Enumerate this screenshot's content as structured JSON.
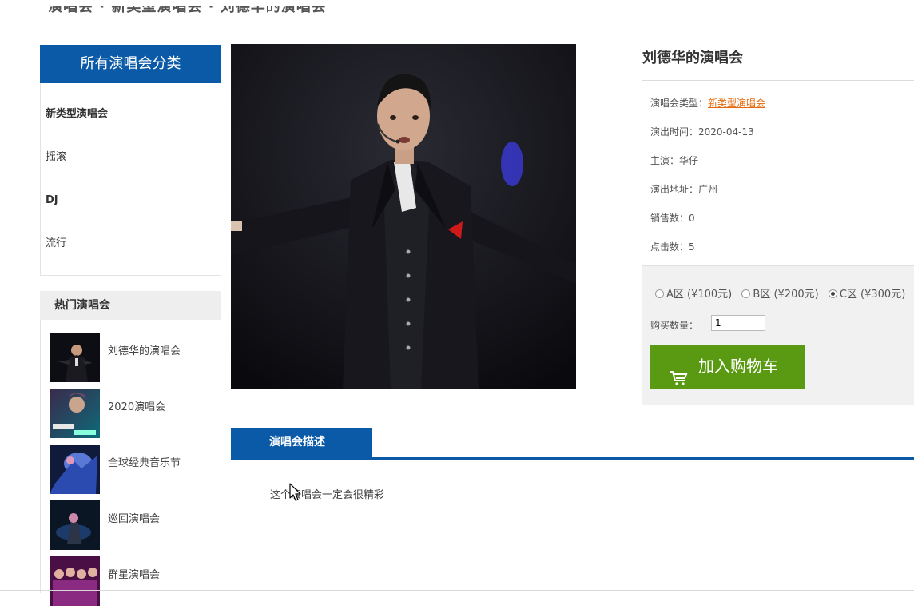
{
  "breadcrumb": "演唱会 · 新类型演唱会 · 刘德华的演唱会",
  "categories": {
    "heading": "所有演唱会分类",
    "items": [
      "新类型演唱会",
      "摇滚",
      "DJ",
      "流行"
    ]
  },
  "hot": {
    "heading": "热门演唱会",
    "items": [
      "刘德华的演唱会",
      "2020演唱会",
      "全球经典音乐节",
      "巡回演唱会",
      "群星演唱会"
    ]
  },
  "detail": {
    "title": "刘德华的演唱会",
    "type_label": "演唱会类型：",
    "type_value": "新类型演唱会",
    "time": "演出时间：2020-04-13",
    "star": "主演：华仔",
    "address": "演出地址：广州",
    "sales": "销售数：0",
    "clicks": "点击数：5"
  },
  "purchase": {
    "zones": [
      "A区 (¥100元)",
      "B区 (¥200元)",
      "C区 (¥300元)"
    ],
    "selected_zone": 2,
    "qty_label": "购买数量：",
    "qty_value": "1",
    "cart_label": "加入购物车"
  },
  "description": {
    "tab_label": "演唱会描述",
    "text": "这个演唱会一定会很精彩"
  },
  "colors": {
    "brand_blue": "#0b5aa8",
    "cart_green": "#5a9a12",
    "link_orange": "#e8690c"
  }
}
